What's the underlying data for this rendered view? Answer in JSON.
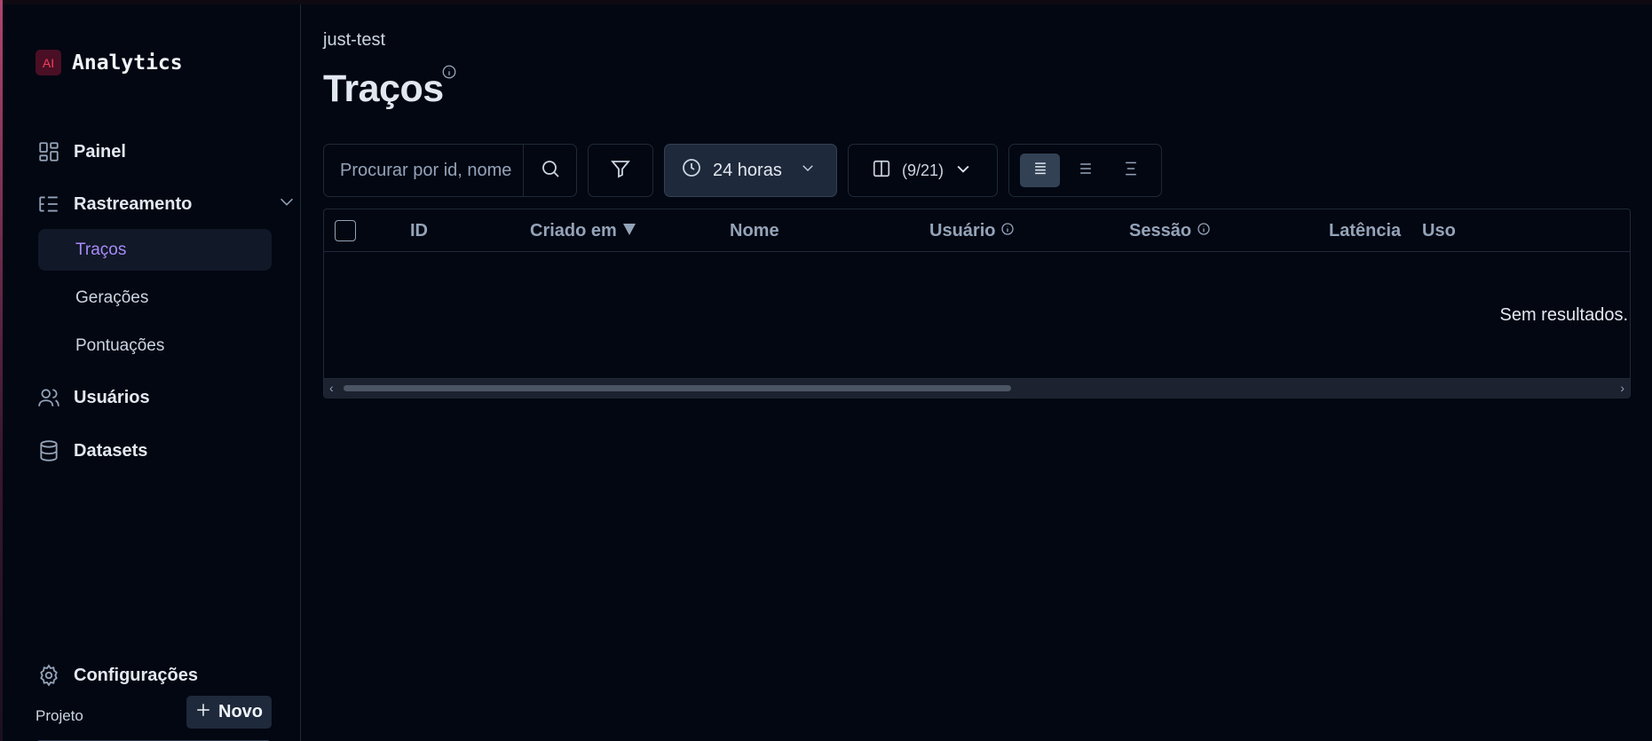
{
  "app": {
    "logo_text": "AI",
    "name": "Analytics"
  },
  "sidebar": {
    "items": [
      {
        "label": "Painel",
        "icon": "dashboard-icon"
      },
      {
        "label": "Rastreamento",
        "icon": "tracing-icon",
        "expanded": true
      },
      {
        "label": "Usuários",
        "icon": "users-icon"
      },
      {
        "label": "Datasets",
        "icon": "database-icon"
      }
    ],
    "sub_items": [
      {
        "label": "Traços",
        "active": true
      },
      {
        "label": "Gerações",
        "active": false
      },
      {
        "label": "Pontuações",
        "active": false
      }
    ],
    "settings_label": "Configurações",
    "project_label": "Projeto",
    "new_button_label": "Novo"
  },
  "header": {
    "breadcrumb": "just-test",
    "title": "Traços"
  },
  "toolbar": {
    "search_placeholder": "Procurar por id, nome",
    "time_range": "24 horas",
    "columns_count": "(9/21)",
    "density_selected": "compact"
  },
  "table": {
    "columns": [
      {
        "label": "ID"
      },
      {
        "label": "Criado em",
        "sort": "desc"
      },
      {
        "label": "Nome"
      },
      {
        "label": "Usuário",
        "info": true
      },
      {
        "label": "Sessão",
        "info": true
      },
      {
        "label": "Latência"
      },
      {
        "label": "Uso"
      }
    ],
    "empty_text": "Sem resultados."
  },
  "colors": {
    "background": "#030712",
    "active_text": "#a78bfa",
    "brand_accent": "#f43f5e"
  }
}
